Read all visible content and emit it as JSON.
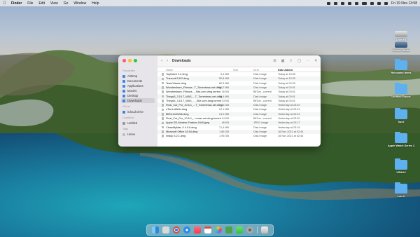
{
  "menubar": {
    "items": [
      "Finder",
      "File",
      "Edit",
      "View",
      "Go",
      "Window",
      "Help"
    ],
    "clock": "Fri 19 Nov 13:58"
  },
  "window": {
    "title": "Downloads",
    "sidebar": {
      "favourites_header": "Favourites",
      "favourites": [
        "AirDrop",
        "Documents",
        "Applications",
        "Movies",
        "Desktop",
        "Downloads"
      ],
      "icloud_header": "iCloud",
      "icloud": [
        "iCloud Drive"
      ],
      "locations_header": "Locations",
      "locations": [
        "Untitled"
      ],
      "tags_header": "Tags",
      "tags": [
        "Home"
      ]
    },
    "columns": {
      "name": "Name",
      "size": "Size",
      "kind": "Kind",
      "date": "Date Added"
    },
    "files": [
      {
        "name": "TopNotch 1.2.dmg",
        "size": "5,9 MB",
        "kind": "Disk Image",
        "date": "Today at 13:55"
      },
      {
        "name": "Transmit 5.8.2.dmg",
        "size": "52,8 MB",
        "kind": "Disk Image",
        "date": "Today at 13:32"
      },
      {
        "name": "TeamViewer.dmg",
        "size": "80,3 MB",
        "kind": "Disk Image",
        "date": "Today at 00:03"
      },
      {
        "name": "Wondershare_Filmora...T_Torrentmac.net.dmg",
        "size": "364,2 MB",
        "kind": "Disk Image",
        "date": "Today at 00:01"
      },
      {
        "name": "Wondershare_Filmora..._Site.com.dmg.torrent",
        "size": "16 KB",
        "kind": "BitTorr...current",
        "date": "Today at 00:01"
      },
      {
        "name": "Things3_3.15.7_MAS_...T_Torrentmac.net.dmg",
        "size": "38,4 MB",
        "kind": "Disk Image",
        "date": "Today at 00:01"
      },
      {
        "name": "Things3_3.15.7_MAS_..._Site.com.dmg.torrent",
        "size": "13 KB",
        "kind": "BitTorr...current",
        "date": "Today at 00:01"
      },
      {
        "name": "Final_Cut_Pro_10.6.1_...T_Torrentmac.net.dmg",
        "size": "2,46 GB",
        "kind": "Disk Image",
        "date": "Yesterday at 23:49"
      },
      {
        "name": "uTorrentWeb.dmg",
        "size": "12,1 MB",
        "kind": "Disk Image",
        "date": "Yesterday at 23:31"
      },
      {
        "name": "BitTorrentWeb.dmg",
        "size": "13,2 MB",
        "kind": "Disk Image",
        "date": "Yesterday at 23:31"
      },
      {
        "name": "Final_Cut_Pro_10.6.1_...rrmac.net.dmg.torrent",
        "size": "14 KB",
        "kind": "BitTorr...current",
        "date": "Yesterday at 23:20"
      },
      {
        "name": "Apple-SD-Modem-Feature-16x9.jpeg",
        "size": "46 KB",
        "kind": "JPEG image",
        "date": "Yesterday at 23:17"
      },
      {
        "name": "CleanMyMac X 4.9.6.dmg",
        "size": "71,4 MB",
        "kind": "Disk Image",
        "date": "Yesterday at 23:15"
      },
      {
        "name": "Microsoft Office 16.54.dmg",
        "size": "1,86 GB",
        "kind": "Disk Image",
        "date": "16 Nov 2021 at 02:44"
      },
      {
        "name": "Instup 3.2.1.dmg",
        "size": "1,95 GB",
        "kind": "Disk Image",
        "date": "16 Nov 2021 at 02:44"
      }
    ]
  },
  "desktop": {
    "icons": [
      {
        "label": "Untitled",
        "type": "drive"
      },
      {
        "label": "Screen Shots",
        "type": "image"
      },
      {
        "label": "Relocated Items",
        "type": "folder"
      },
      {
        "label": "Untitled Export",
        "type": "folder"
      },
      {
        "label": "Sps2",
        "type": "folder"
      },
      {
        "label": "Apple Watch Series 3",
        "type": "folder"
      },
      {
        "label": "XSMAX",
        "type": "folder"
      },
      {
        "label": "Lan 2",
        "type": "folder"
      }
    ]
  },
  "dock": {
    "apps": [
      "finder-icon",
      "launchpad-icon",
      "chrome-icon",
      "safari-icon",
      "music-icon",
      "calendar-icon",
      "photos-icon",
      "utorrent-icon",
      "messages-icon",
      "settings-icon",
      "trash-icon"
    ]
  }
}
